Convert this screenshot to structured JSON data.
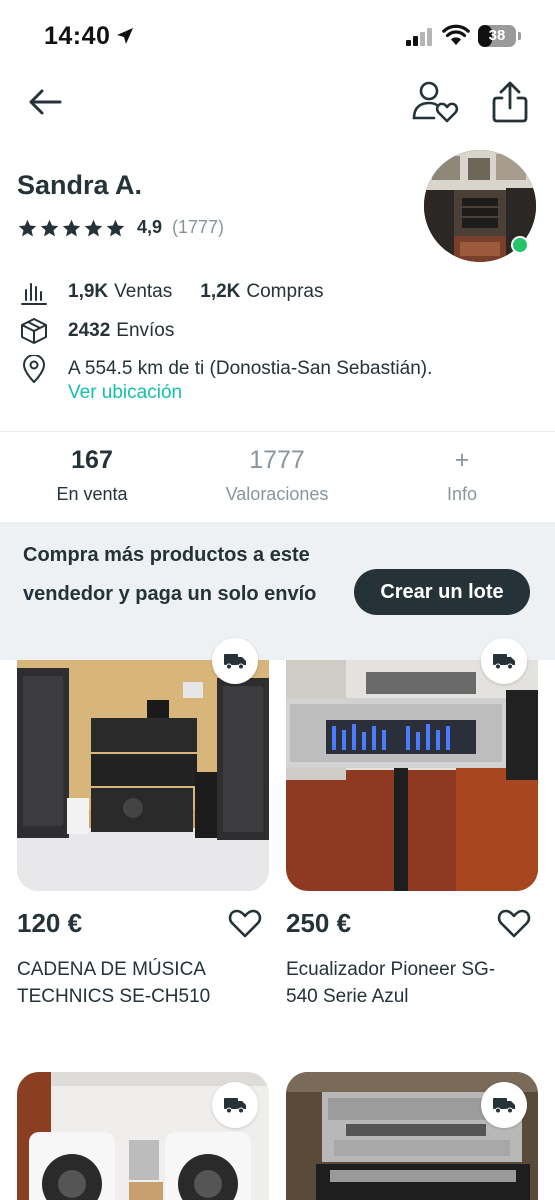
{
  "status_bar": {
    "time": "14:40",
    "battery": "38",
    "battery_level": 0.38
  },
  "nav": {
    "back_icon": "arrow-left-icon",
    "follow_icon": "user-heart-icon",
    "share_icon": "share-icon"
  },
  "profile": {
    "name": "Sandra A.",
    "rating_value": "4,9",
    "rating_count": "(1777)",
    "stars": 5,
    "online": true,
    "stats": {
      "sales_num": "1,9K",
      "sales_label": "Ventas",
      "purchases_num": "1,2K",
      "purchases_label": "Compras",
      "shipments_num": "2432",
      "shipments_label": "Envíos",
      "location_text": "A 554.5 km de ti (Donostia-San Sebastián).",
      "see_location": "Ver ubicación"
    }
  },
  "tabs": [
    {
      "value": "167",
      "label": "En venta",
      "active": true
    },
    {
      "value": "1777",
      "label": "Valoraciones",
      "active": false
    },
    {
      "value": "+",
      "label": "Info",
      "active": false
    }
  ],
  "lote_banner": {
    "text": "Compra más productos a este vendedor y paga un solo envío",
    "button": "Crear un lote"
  },
  "products": [
    {
      "price": "120 €",
      "title": "CADENA DE MÚSICA TECHNICS SE-CH510",
      "shipping_icon": "truck-icon"
    },
    {
      "price": "250 €",
      "title": "Ecualizador Pioneer SG-540 Serie Azul",
      "shipping_icon": "truck-icon"
    },
    {
      "shipping_icon": "truck-icon"
    },
    {
      "shipping_icon": "truck-icon"
    }
  ],
  "colors": {
    "text": "#253238",
    "accent": "#13c1ac",
    "muted": "#8a959b",
    "online": "#27c26c",
    "banner_bg": "#eef1f3"
  }
}
